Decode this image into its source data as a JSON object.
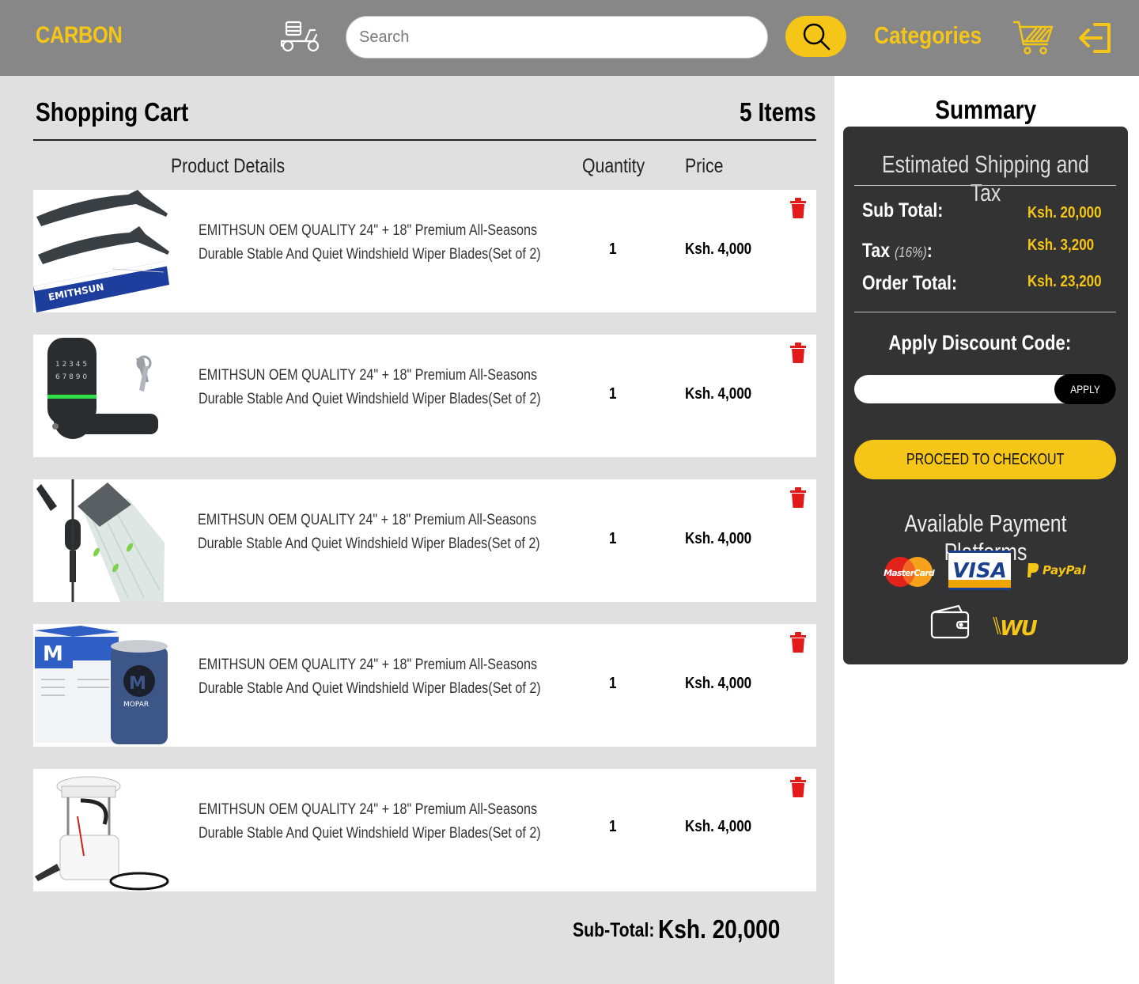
{
  "header": {
    "brand": "CARBON",
    "search_placeholder": "Search",
    "categories_label": "Categories",
    "icons": [
      "delivery-scooter-icon",
      "search-icon",
      "shopping-cart-icon",
      "logout-icon"
    ]
  },
  "cart": {
    "title": "Shopping Cart",
    "item_count": "5 Items",
    "columns": {
      "details": "Product Details",
      "quantity": "Quantity",
      "price": "Price"
    },
    "items": [
      {
        "line1": "EMITHSUN OEM QUALITY 24\" + 18\" Premium All-Seasons",
        "line2": "Durable Stable And Quiet Windshield Wiper Blades(Set of 2)",
        "quantity": "1",
        "price": "Ksh. 4,000",
        "image": "wiper-blades"
      },
      {
        "line1": "EMITHSUN OEM QUALITY 24\" + 18\" Premium All-Seasons",
        "line2": "Durable Stable And Quiet Windshield Wiper Blades(Set of 2)",
        "quantity": "1",
        "price": "Ksh. 4,000",
        "image": "keypad-door-lock"
      },
      {
        "line1": "EMITHSUN OEM QUALITY 24\" + 18\" Premium All-Seasons",
        "line2": "Durable Stable And Quiet Windshield Wiper Blades(Set of 2)",
        "quantity": "1",
        "price": "Ksh. 4,000",
        "image": "shower-head"
      },
      {
        "line1": "EMITHSUN OEM QUALITY 24\" + 18\" Premium All-Seasons",
        "line2": "Durable Stable And Quiet Windshield Wiper Blades(Set of 2)",
        "quantity": "1",
        "price": "Ksh. 4,000",
        "image": "mopar-oil-filter"
      },
      {
        "line1": "EMITHSUN OEM QUALITY 24\" + 18\" Premium All-Seasons",
        "line2": "Durable Stable And Quiet Windshield Wiper Blades(Set of 2)",
        "quantity": "1",
        "price": "Ksh. 4,000",
        "image": "fuel-pump-assembly"
      }
    ],
    "subtotal_label": "Sub-Total:",
    "subtotal_value": "Ksh. 20,000"
  },
  "summary": {
    "title": "Summary",
    "estimate_heading": "Estimated Shipping and Tax",
    "sub_total_label": "Sub Total:",
    "sub_total_value": "Ksh. 20,000",
    "tax_label": "Tax",
    "tax_rate": "(16%)",
    "tax_colon": ":",
    "tax_value": "Ksh. 3,200",
    "order_total_label": "Order Total:",
    "order_total_value": "Ksh. 23,200",
    "discount_label": "Apply Discount Code:",
    "discount_value": "",
    "apply_label": "APPLY",
    "checkout_label": "PROCEED TO CHECKOUT",
    "platforms_title": "Available Payment Platforms",
    "platforms": {
      "mastercard": "MasterCard",
      "visa": "VISA",
      "paypal": "PayPal",
      "wallet_icon": "wallet-icon",
      "western_union": "WU"
    }
  },
  "colors": {
    "accent": "#f5c518",
    "header_bg": "#878787",
    "panel_bg": "#e0e0e0",
    "summary_bg": "#333333",
    "delete": "#e11a1a"
  }
}
